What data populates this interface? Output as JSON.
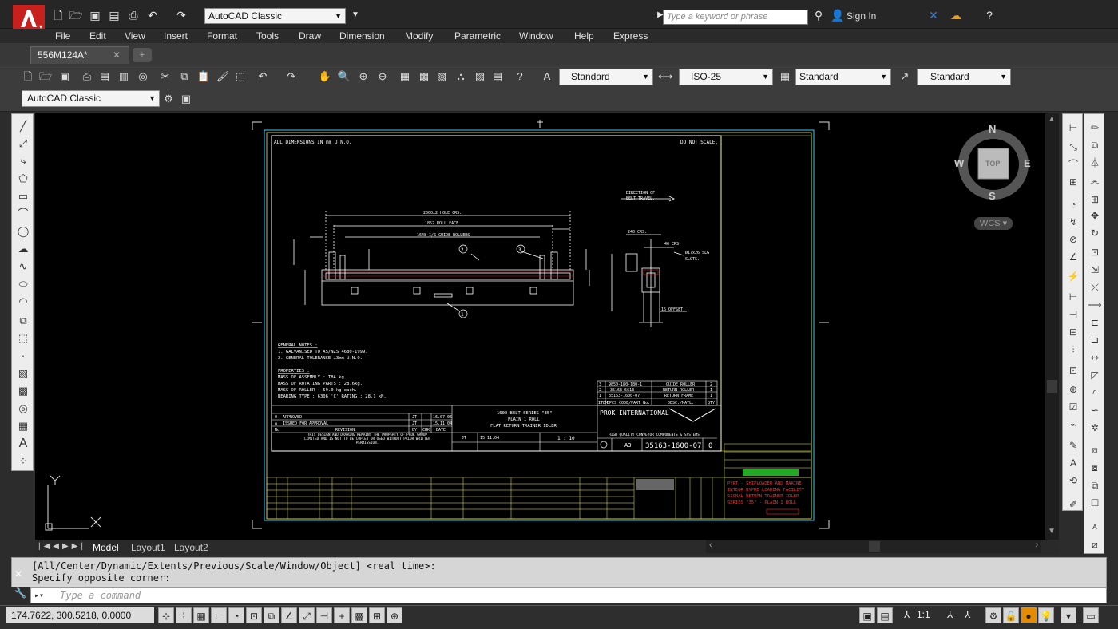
{
  "app": {
    "workspace": "AutoCAD Classic",
    "search_placeholder": "Type a keyword or phrase",
    "sign_in": "Sign In"
  },
  "menu": [
    "File",
    "Edit",
    "View",
    "Insert",
    "Format",
    "Tools",
    "Draw",
    "Dimension",
    "Modify",
    "Parametric",
    "Window",
    "Help",
    "Express"
  ],
  "document_tab": {
    "name": "556M124A*"
  },
  "toolbar": {
    "text_style": "Standard",
    "dim_style": "ISO-25",
    "table_style": "Standard",
    "mleader_style": "Standard",
    "workspace2": "AutoCAD Classic"
  },
  "layout_tabs": [
    "Model",
    "Layout1",
    "Layout2"
  ],
  "command_history": [
    "[All/Center/Dynamic/Extents/Previous/Scale/Window/Object] <real time>:",
    "Specify opposite corner:"
  ],
  "command_placeholder": "Type a command",
  "status": {
    "coords": "174.7622, 300.5218, 0.0000",
    "annotation_scale": "1:1"
  },
  "navcube": {
    "n": "N",
    "s": "S",
    "e": "E",
    "w": "W",
    "face": "TOP",
    "wcs": "WCS"
  },
  "drawing": {
    "header_left": "ALL DIMENSIONS IN mm U.N.O.",
    "header_right": "DO NOT SCALE.",
    "dims": [
      "2000x2 HOLE CRS.",
      "1852 ROLL FACE",
      "1648 I/S GUIDE ROLLERS",
      "240 CRS.",
      "40 CRS.",
      "Ø17x26 SLG",
      "SLOTS.",
      "15 OFFSET.",
      "DIRECTION OF",
      "BELT TRAVEL."
    ],
    "notes_title": "GENERAL NOTES :",
    "notes": [
      "1. GALVANISED TO AS/NZS 4680-1999.",
      "2. GENERAL TOLERANCE ±3mm U.N.O."
    ],
    "props_title": "PROPERTIES :",
    "props": [
      "MASS OF ASSEMBLY : TBA kg.",
      "MASS OF ROTATING PARTS : 28.6kg.",
      "MASS OF ROLLER : 59.0 kg each.",
      "BEARING TYPE : 6306    'C' RATING : 28.1 kN."
    ],
    "bom": [
      [
        "3",
        "9850-180-180-1",
        "GUIDE ROLLER",
        "2"
      ],
      [
        "2",
        "35163-6613",
        "RETURN ROLLER",
        "1"
      ],
      [
        "1",
        "35163-1600-07",
        "RETURN FRAME",
        "1"
      ]
    ],
    "bom_header": [
      "ITEM",
      "BPCS CODE/PART No.",
      "DESC./MATL.",
      "QTY"
    ],
    "title_block": {
      "desc1": "1600 BELT SERIES \"35\"",
      "desc2": "PLAIN 1 ROLL",
      "desc3": "FLAT RETURN TRAINER IDLER",
      "company": "PROK INTERNATIONAL",
      "tagline": "HIGH QUALITY CONVEYOR COMPONENTS & SYSTEMS",
      "size": "A3",
      "drawing_no": "35163-1600-07",
      "rev": "0",
      "scale": "1 : 10",
      "date": "15.11.04",
      "drawn": "JT"
    },
    "revisions": [
      [
        "0",
        "APPROVED.",
        "JT",
        "16.07.05"
      ],
      [
        "A",
        "ISSUED FOR APPROVAL",
        "JT",
        "15.11.04"
      ]
    ],
    "rev_header": [
      "No",
      "REVISION",
      "BY",
      "CHK",
      "DATE"
    ],
    "disclaimer": "THIS DESIGN AND DRAWING REMAINS THE PROPERTY OF PROK GROUP LIMITED AND IS NOT TO BE COPIED OR USED WITHOUT PRIOR WRITTEN PERMISSION.",
    "red_title": [
      "PYRT - SHIPLOADER AND MARINE",
      "INTEGR BYPRE LOADING FACILITY",
      "SIGNAL RETURN TRAINER IDLER",
      "SERIES \"35\" - PLAIN 1 ROLL"
    ]
  }
}
